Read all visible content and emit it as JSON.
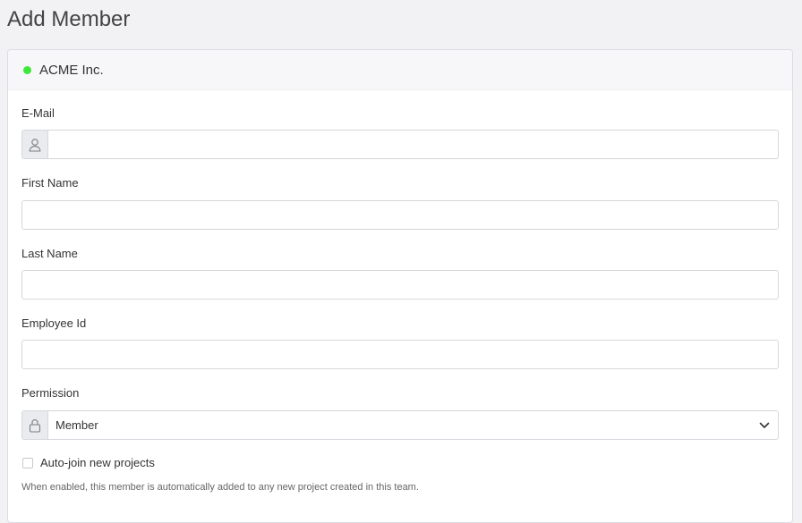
{
  "page": {
    "title": "Add Member"
  },
  "organization": {
    "name": "ACME Inc.",
    "status_color": "#3ee83a"
  },
  "form": {
    "email": {
      "label": "E-Mail",
      "value": "",
      "placeholder": "",
      "icon": "user-icon"
    },
    "first_name": {
      "label": "First Name",
      "value": "",
      "placeholder": ""
    },
    "last_name": {
      "label": "Last Name",
      "value": "",
      "placeholder": ""
    },
    "employee_id": {
      "label": "Employee Id",
      "value": "",
      "placeholder": ""
    },
    "permission": {
      "label": "Permission",
      "selected": "Member",
      "icon": "lock-icon"
    },
    "auto_join": {
      "label": "Auto-join new projects",
      "checked": false,
      "help": "When enabled, this member is automatically added to any new project created in this team."
    }
  }
}
